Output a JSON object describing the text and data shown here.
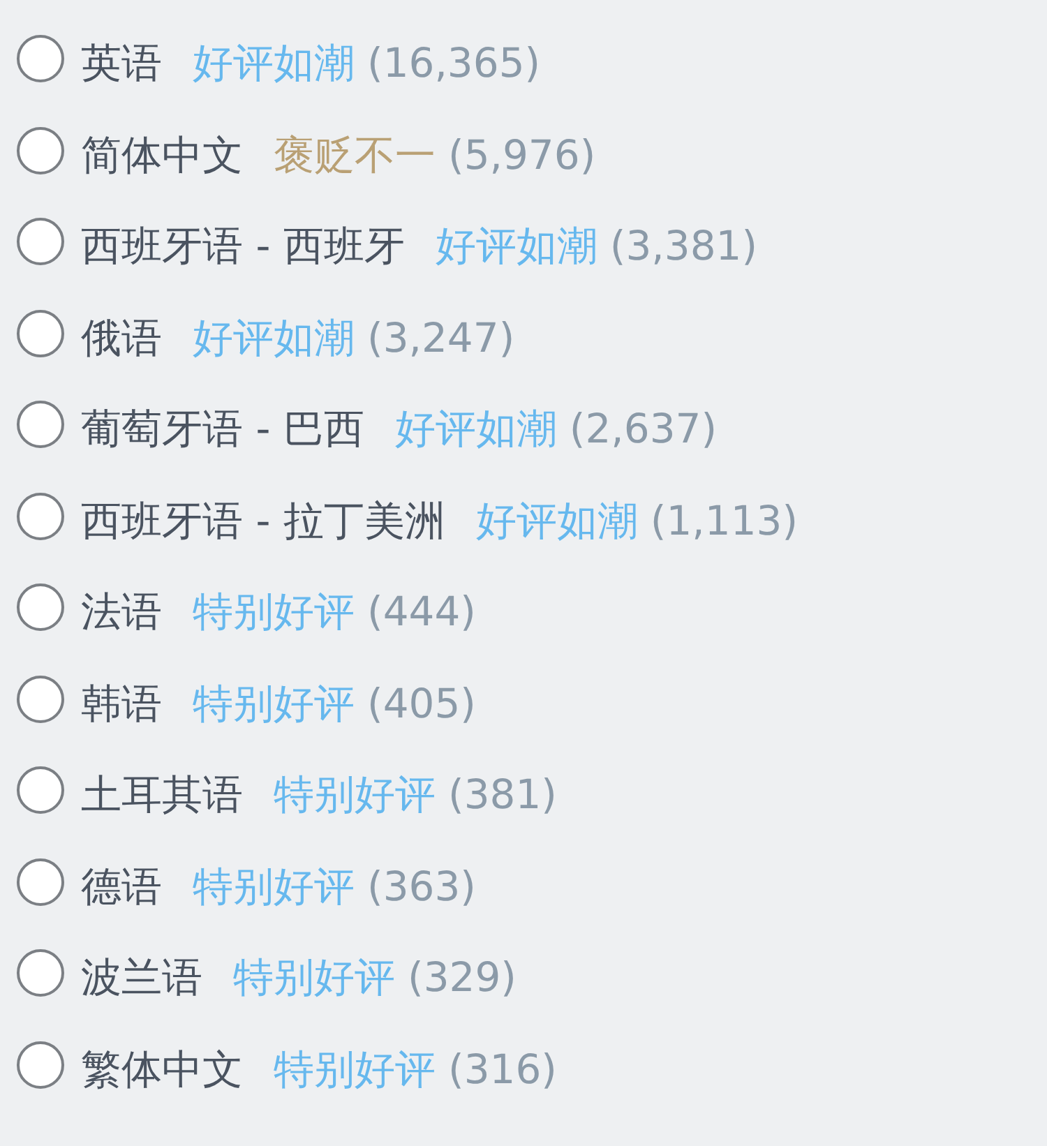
{
  "languages": [
    {
      "name": "英语",
      "rating": "好评如潮",
      "color": "#66b8ee",
      "count": "(16,365)",
      "selected": false
    },
    {
      "name": "简体中文",
      "rating": "褒贬不一",
      "color": "#b9a074",
      "count": "(5,976)",
      "selected": false
    },
    {
      "name": "西班牙语 - 西班牙",
      "rating": "好评如潮",
      "color": "#66b8ee",
      "count": "(3,381)",
      "selected": false
    },
    {
      "name": "俄语",
      "rating": "好评如潮",
      "color": "#66b8ee",
      "count": "(3,247)",
      "selected": false
    },
    {
      "name": "葡萄牙语 - 巴西",
      "rating": "好评如潮",
      "color": "#66b8ee",
      "count": "(2,637)",
      "selected": false
    },
    {
      "name": "西班牙语 - 拉丁美洲",
      "rating": "好评如潮",
      "color": "#66b8ee",
      "count": "(1,113)",
      "selected": false
    },
    {
      "name": "法语",
      "rating": "特别好评",
      "color": "#66b8ee",
      "count": "(444)",
      "selected": false
    },
    {
      "name": "韩语",
      "rating": "特别好评",
      "color": "#66b8ee",
      "count": "(405)",
      "selected": false
    },
    {
      "name": "土耳其语",
      "rating": "特别好评",
      "color": "#66b8ee",
      "count": "(381)",
      "selected": false
    },
    {
      "name": "德语",
      "rating": "特别好评",
      "color": "#66b8ee",
      "count": "(363)",
      "selected": false
    },
    {
      "name": "波兰语",
      "rating": "特别好评",
      "color": "#66b8ee",
      "count": "(329)",
      "selected": false
    },
    {
      "name": "繁体中文",
      "rating": "特别好评",
      "color": "#66b8ee",
      "count": "(316)",
      "selected": false
    }
  ]
}
